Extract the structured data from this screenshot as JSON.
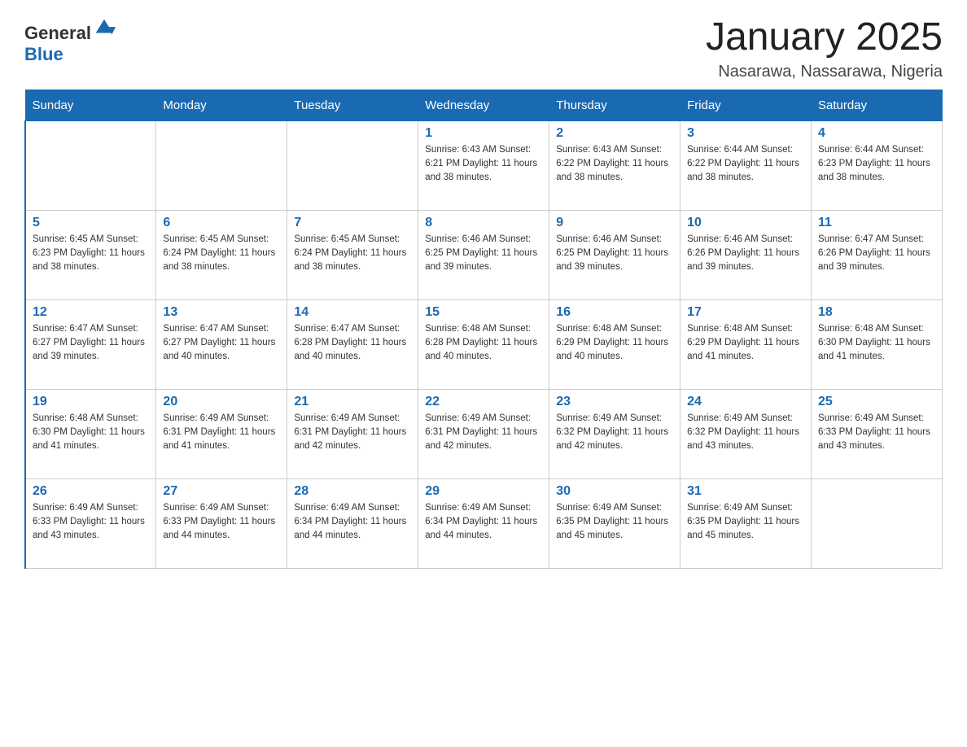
{
  "logo": {
    "general": "General",
    "blue": "Blue"
  },
  "title": "January 2025",
  "location": "Nasarawa, Nassarawa, Nigeria",
  "headers": [
    "Sunday",
    "Monday",
    "Tuesday",
    "Wednesday",
    "Thursday",
    "Friday",
    "Saturday"
  ],
  "weeks": [
    [
      {
        "day": "",
        "info": ""
      },
      {
        "day": "",
        "info": ""
      },
      {
        "day": "",
        "info": ""
      },
      {
        "day": "1",
        "info": "Sunrise: 6:43 AM\nSunset: 6:21 PM\nDaylight: 11 hours and 38 minutes."
      },
      {
        "day": "2",
        "info": "Sunrise: 6:43 AM\nSunset: 6:22 PM\nDaylight: 11 hours and 38 minutes."
      },
      {
        "day": "3",
        "info": "Sunrise: 6:44 AM\nSunset: 6:22 PM\nDaylight: 11 hours and 38 minutes."
      },
      {
        "day": "4",
        "info": "Sunrise: 6:44 AM\nSunset: 6:23 PM\nDaylight: 11 hours and 38 minutes."
      }
    ],
    [
      {
        "day": "5",
        "info": "Sunrise: 6:45 AM\nSunset: 6:23 PM\nDaylight: 11 hours and 38 minutes."
      },
      {
        "day": "6",
        "info": "Sunrise: 6:45 AM\nSunset: 6:24 PM\nDaylight: 11 hours and 38 minutes."
      },
      {
        "day": "7",
        "info": "Sunrise: 6:45 AM\nSunset: 6:24 PM\nDaylight: 11 hours and 38 minutes."
      },
      {
        "day": "8",
        "info": "Sunrise: 6:46 AM\nSunset: 6:25 PM\nDaylight: 11 hours and 39 minutes."
      },
      {
        "day": "9",
        "info": "Sunrise: 6:46 AM\nSunset: 6:25 PM\nDaylight: 11 hours and 39 minutes."
      },
      {
        "day": "10",
        "info": "Sunrise: 6:46 AM\nSunset: 6:26 PM\nDaylight: 11 hours and 39 minutes."
      },
      {
        "day": "11",
        "info": "Sunrise: 6:47 AM\nSunset: 6:26 PM\nDaylight: 11 hours and 39 minutes."
      }
    ],
    [
      {
        "day": "12",
        "info": "Sunrise: 6:47 AM\nSunset: 6:27 PM\nDaylight: 11 hours and 39 minutes."
      },
      {
        "day": "13",
        "info": "Sunrise: 6:47 AM\nSunset: 6:27 PM\nDaylight: 11 hours and 40 minutes."
      },
      {
        "day": "14",
        "info": "Sunrise: 6:47 AM\nSunset: 6:28 PM\nDaylight: 11 hours and 40 minutes."
      },
      {
        "day": "15",
        "info": "Sunrise: 6:48 AM\nSunset: 6:28 PM\nDaylight: 11 hours and 40 minutes."
      },
      {
        "day": "16",
        "info": "Sunrise: 6:48 AM\nSunset: 6:29 PM\nDaylight: 11 hours and 40 minutes."
      },
      {
        "day": "17",
        "info": "Sunrise: 6:48 AM\nSunset: 6:29 PM\nDaylight: 11 hours and 41 minutes."
      },
      {
        "day": "18",
        "info": "Sunrise: 6:48 AM\nSunset: 6:30 PM\nDaylight: 11 hours and 41 minutes."
      }
    ],
    [
      {
        "day": "19",
        "info": "Sunrise: 6:48 AM\nSunset: 6:30 PM\nDaylight: 11 hours and 41 minutes."
      },
      {
        "day": "20",
        "info": "Sunrise: 6:49 AM\nSunset: 6:31 PM\nDaylight: 11 hours and 41 minutes."
      },
      {
        "day": "21",
        "info": "Sunrise: 6:49 AM\nSunset: 6:31 PM\nDaylight: 11 hours and 42 minutes."
      },
      {
        "day": "22",
        "info": "Sunrise: 6:49 AM\nSunset: 6:31 PM\nDaylight: 11 hours and 42 minutes."
      },
      {
        "day": "23",
        "info": "Sunrise: 6:49 AM\nSunset: 6:32 PM\nDaylight: 11 hours and 42 minutes."
      },
      {
        "day": "24",
        "info": "Sunrise: 6:49 AM\nSunset: 6:32 PM\nDaylight: 11 hours and 43 minutes."
      },
      {
        "day": "25",
        "info": "Sunrise: 6:49 AM\nSunset: 6:33 PM\nDaylight: 11 hours and 43 minutes."
      }
    ],
    [
      {
        "day": "26",
        "info": "Sunrise: 6:49 AM\nSunset: 6:33 PM\nDaylight: 11 hours and 43 minutes."
      },
      {
        "day": "27",
        "info": "Sunrise: 6:49 AM\nSunset: 6:33 PM\nDaylight: 11 hours and 44 minutes."
      },
      {
        "day": "28",
        "info": "Sunrise: 6:49 AM\nSunset: 6:34 PM\nDaylight: 11 hours and 44 minutes."
      },
      {
        "day": "29",
        "info": "Sunrise: 6:49 AM\nSunset: 6:34 PM\nDaylight: 11 hours and 44 minutes."
      },
      {
        "day": "30",
        "info": "Sunrise: 6:49 AM\nSunset: 6:35 PM\nDaylight: 11 hours and 45 minutes."
      },
      {
        "day": "31",
        "info": "Sunrise: 6:49 AM\nSunset: 6:35 PM\nDaylight: 11 hours and 45 minutes."
      },
      {
        "day": "",
        "info": ""
      }
    ]
  ]
}
